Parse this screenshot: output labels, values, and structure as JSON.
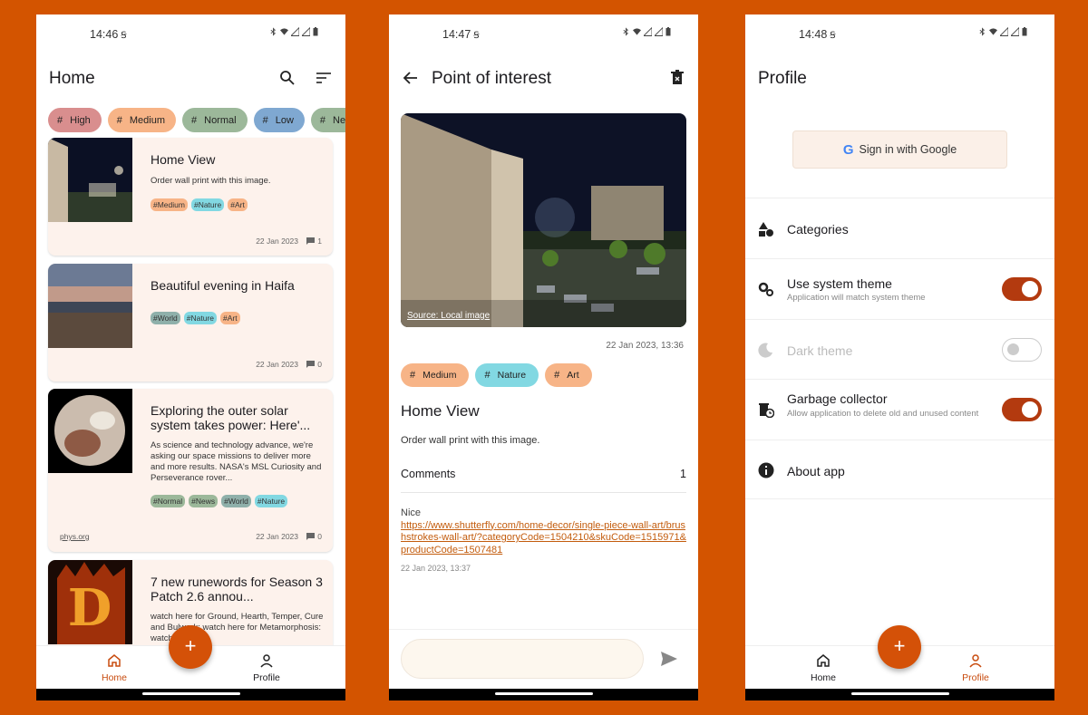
{
  "colors": {
    "accent": "#d45108",
    "background": "#d35400",
    "card": "#fdf2ec",
    "switch_on": "#b33a0f"
  },
  "home": {
    "status_time": "14:46",
    "title": "Home",
    "chips": [
      {
        "label": "High",
        "color": "#d98e8e"
      },
      {
        "label": "Medium",
        "color": "#f7b487"
      },
      {
        "label": "Normal",
        "color": "#9cb89a"
      },
      {
        "label": "Low",
        "color": "#7fa8d1"
      },
      {
        "label": "News",
        "color": "#9cb89a"
      }
    ],
    "cards": [
      {
        "title": "Home View",
        "desc": "Order wall print with this image.",
        "tags": [
          "#Medium",
          "#Nature",
          "#Art"
        ],
        "date": "22 Jan 2023",
        "comments": "1"
      },
      {
        "title": "Beautiful evening in Haifa",
        "tags": [
          "#World",
          "#Nature",
          "#Art"
        ],
        "date": "22 Jan 2023",
        "comments": "0"
      },
      {
        "title": "Exploring the outer solar system takes power: Here'...",
        "desc": "As science and technology advance, we're asking our space missions to deliver more and more results. NASA's MSL Curiosity and Perseverance rover...",
        "tags": [
          "#Normal",
          "#News",
          "#World",
          "#Nature"
        ],
        "source": "phys.org",
        "date": "22 Jan 2023",
        "comments": "0"
      },
      {
        "title": "7 new runewords for Season 3 Patch 2.6 annou...",
        "desc": "watch here for Ground, Hearth, Temper, Cure and Bulwark:                watch here for Metamorphosis:               watch here f..."
      }
    ],
    "nav": {
      "home": "Home",
      "profile": "Profile"
    },
    "fab": "+"
  },
  "detail": {
    "status_time": "14:47",
    "title": "Point of interest",
    "photo_source": "Source: Local image",
    "date": "22 Jan 2023, 13:36",
    "chips": [
      {
        "label": "Medium",
        "color": "#f7b487"
      },
      {
        "label": "Nature",
        "color": "#82d8e2"
      },
      {
        "label": "Art",
        "color": "#f7b487"
      }
    ],
    "item_title": "Home View",
    "item_desc": "Order wall print with this image.",
    "comments_label": "Comments",
    "comments_count": "1",
    "comment_text": "Nice",
    "comment_link": "https://www.shutterfly.com/home-decor/single-piece-wall-art/brushstrokes-wall-art/?categoryCode=1504210&skuCode=1515971&productCode=1507481",
    "comment_date": "22 Jan 2023, 13:37"
  },
  "profile": {
    "status_time": "14:48",
    "title": "Profile",
    "signin_label": "Sign in with Google",
    "rows": {
      "categories": "Categories",
      "system_theme": "Use system theme",
      "system_theme_sub": "Application will match system theme",
      "system_theme_on": true,
      "dark_theme": "Dark theme",
      "dark_theme_on": false,
      "gc": "Garbage collector",
      "gc_sub": "Allow application to delete old and unused content",
      "gc_on": true,
      "about": "About app"
    },
    "nav": {
      "home": "Home",
      "profile": "Profile"
    },
    "fab": "+"
  }
}
